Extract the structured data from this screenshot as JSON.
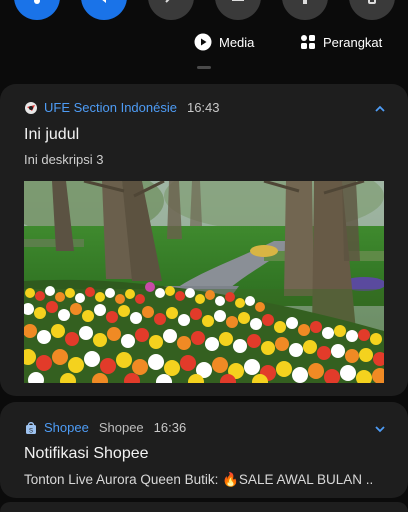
{
  "quick_settings": {
    "tiles": [
      {
        "name": "wifi",
        "state": "on"
      },
      {
        "name": "sound-off",
        "state": "on"
      },
      {
        "name": "bluetooth",
        "state": "off"
      },
      {
        "name": "screen",
        "state": "off"
      },
      {
        "name": "flashlight",
        "state": "off"
      },
      {
        "name": "rotate",
        "state": "off"
      }
    ]
  },
  "media_bar": {
    "media_label": "Media",
    "devices_label": "Perangkat"
  },
  "notifications": [
    {
      "app_name": "UFE Section Indonésie",
      "time": "16:43",
      "title": "Ini judul",
      "description": "Ini deskripsi 3",
      "expanded": true,
      "accent": "#4e9cf5"
    },
    {
      "app_name": "Shopee",
      "sender": "Shopee",
      "time": "16:36",
      "title": "Notifikasi Shopee",
      "description": "Tonton Live Aurora Queen Butik: 🔥SALE AWAL BULAN ..",
      "expanded": false,
      "accent": "#4e9cf5"
    }
  ]
}
